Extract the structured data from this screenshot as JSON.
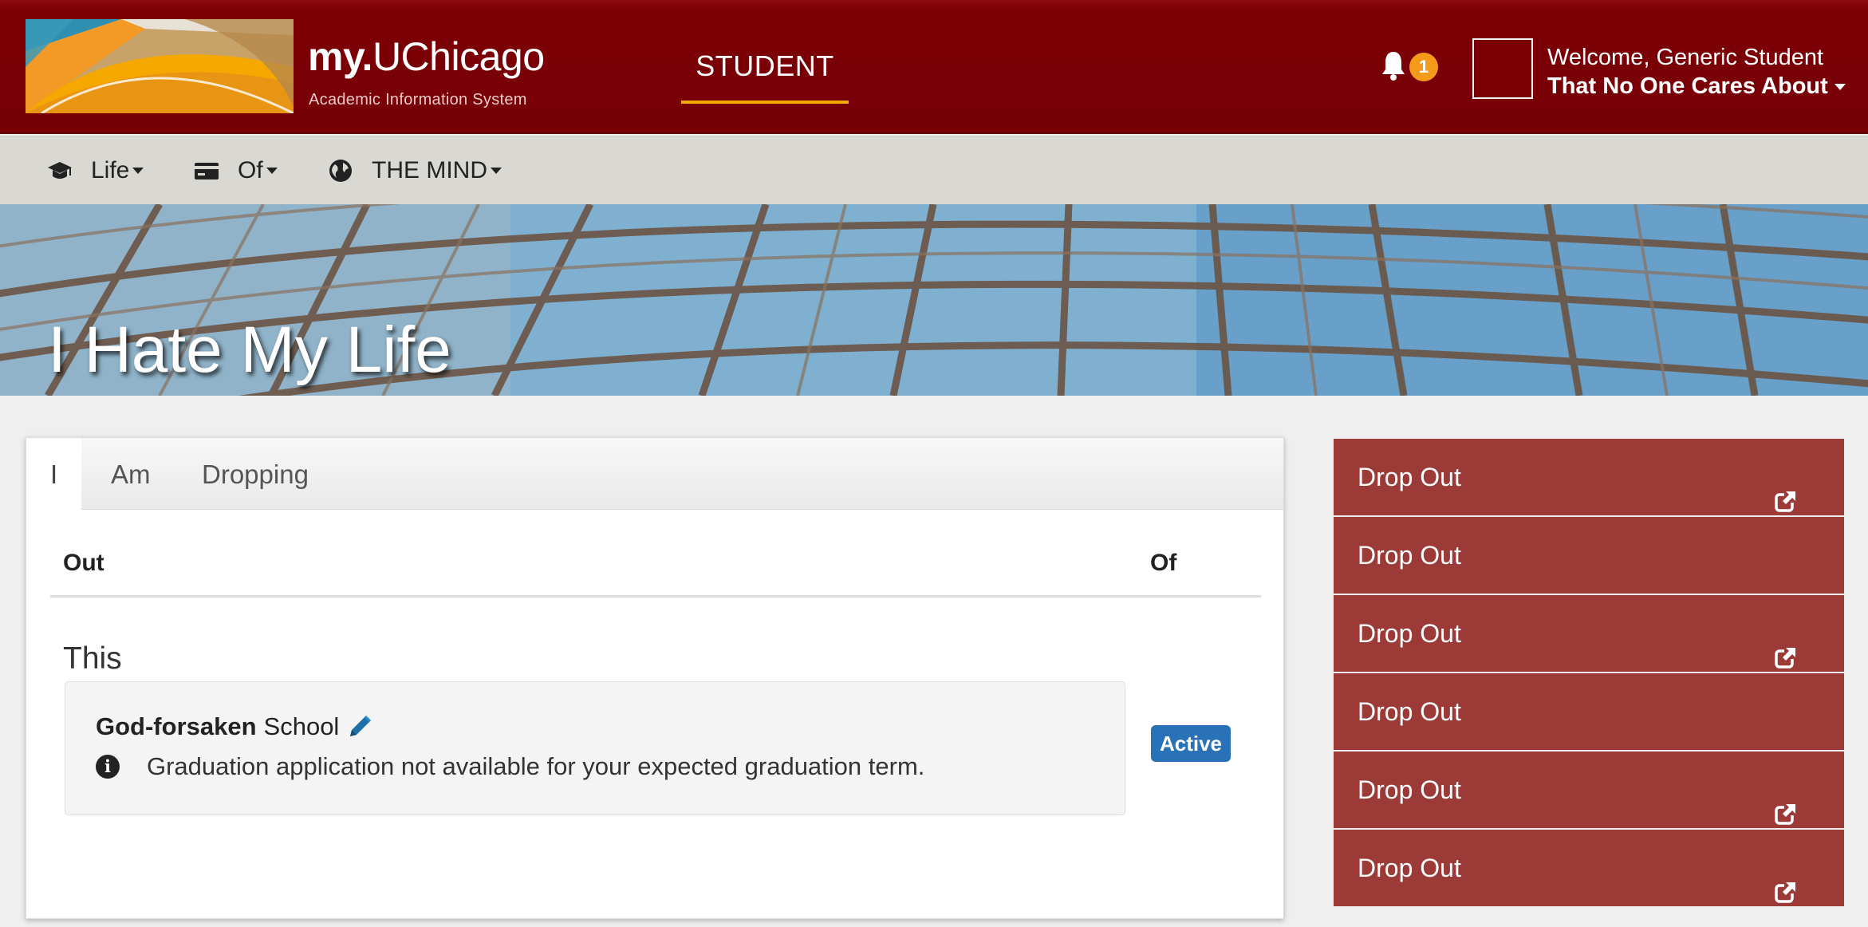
{
  "header": {
    "brand_bold": "my.",
    "brand_rest": "UChicago",
    "brand_sub": "Academic Information System",
    "nav_active": "STUDENT",
    "notification_count": "1",
    "welcome_line": "Welcome, Generic Student",
    "user_name": "That No One Cares About",
    "icons": [
      "bell-icon",
      "user-avatar"
    ],
    "colors": {
      "header_bg": "#7c0005",
      "accent": "#f2a900",
      "badge": "#f49b1c"
    }
  },
  "subnav": {
    "items": [
      {
        "label": "Life",
        "icon": "graduation-cap-icon"
      },
      {
        "label": "Of",
        "icon": "credit-card-icon"
      },
      {
        "label": "THE MIND",
        "icon": "globe-icon"
      }
    ]
  },
  "banner": {
    "title": "I Hate My Life"
  },
  "panel": {
    "tabs": [
      {
        "label": "I",
        "active": true
      },
      {
        "label": "Am",
        "active": false
      },
      {
        "label": "Dropping",
        "active": false
      }
    ],
    "columns": {
      "left": "Out",
      "right": "Of"
    },
    "section_title": "This",
    "program_bold": "God-forsaken",
    "program_rest": "School",
    "info_text": "Graduation application not available for your expected graduation term.",
    "status_badge": "Active",
    "colors": {
      "badge": "#2a72b7"
    }
  },
  "links": {
    "items": [
      {
        "label": "Drop Out",
        "external": true
      },
      {
        "label": "Drop Out",
        "external": false
      },
      {
        "label": "Drop Out",
        "external": true
      },
      {
        "label": "Drop Out",
        "external": false
      },
      {
        "label": "Drop Out",
        "external": true
      },
      {
        "label": "Drop Out",
        "external": true
      }
    ],
    "colors": {
      "bg": "#9c3a37"
    }
  }
}
